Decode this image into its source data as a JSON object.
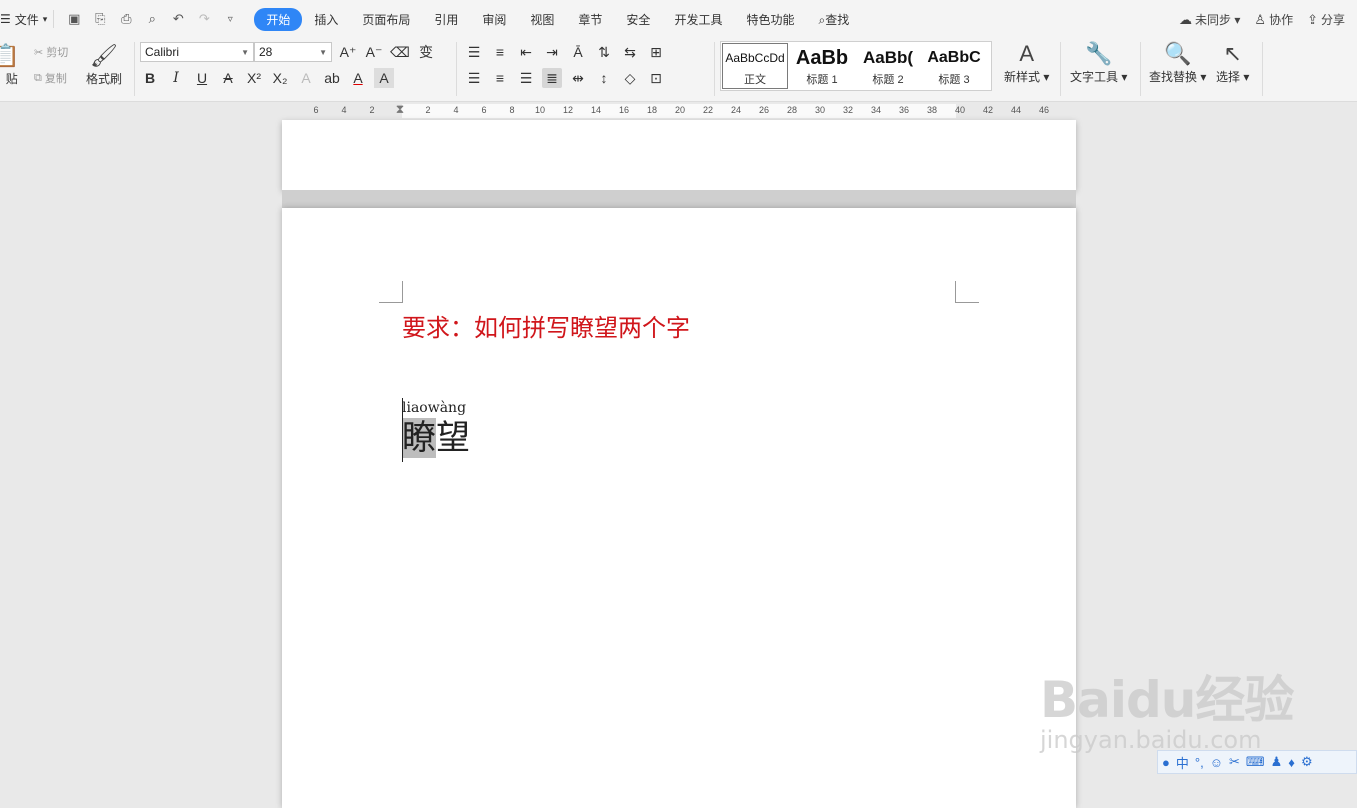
{
  "menu": {
    "file_label": "文件",
    "tabs": [
      "开始",
      "插入",
      "页面布局",
      "引用",
      "审阅",
      "视图",
      "章节",
      "安全",
      "开发工具",
      "特色功能"
    ],
    "active_tab": "开始",
    "search_label": "查找"
  },
  "right": {
    "sync": "未同步",
    "collab": "协作",
    "share": "分享"
  },
  "ribbon": {
    "paste": "贴",
    "cut": "剪切",
    "copy": "复制",
    "format_painter": "格式刷",
    "font_name": "Calibri",
    "font_size": "28",
    "styles": [
      {
        "preview": "AaBbCcDd",
        "name": "正文"
      },
      {
        "preview": "AaBb",
        "name": "标题 1"
      },
      {
        "preview": "AaBb(",
        "name": "标题 2"
      },
      {
        "preview": "AaBbC",
        "name": "标题 3"
      }
    ],
    "new_style": "新样式",
    "text_tools": "文字工具",
    "find_replace": "查找替换",
    "select": "选择"
  },
  "ruler": {
    "left": [
      "6",
      "4",
      "2"
    ],
    "right": [
      "2",
      "4",
      "6",
      "8",
      "10",
      "12",
      "14",
      "16",
      "18",
      "20",
      "22",
      "24",
      "26",
      "28",
      "30",
      "32",
      "34",
      "36",
      "38",
      "40",
      "42",
      "44",
      "46"
    ]
  },
  "document": {
    "requirement": "要求：如何拼写瞭望两个字",
    "pinyin": "liaowàng",
    "char1": "瞭",
    "char2": "望"
  },
  "watermark": {
    "logo": "Baidu经验",
    "sub": "jingyan.baidu.com"
  }
}
